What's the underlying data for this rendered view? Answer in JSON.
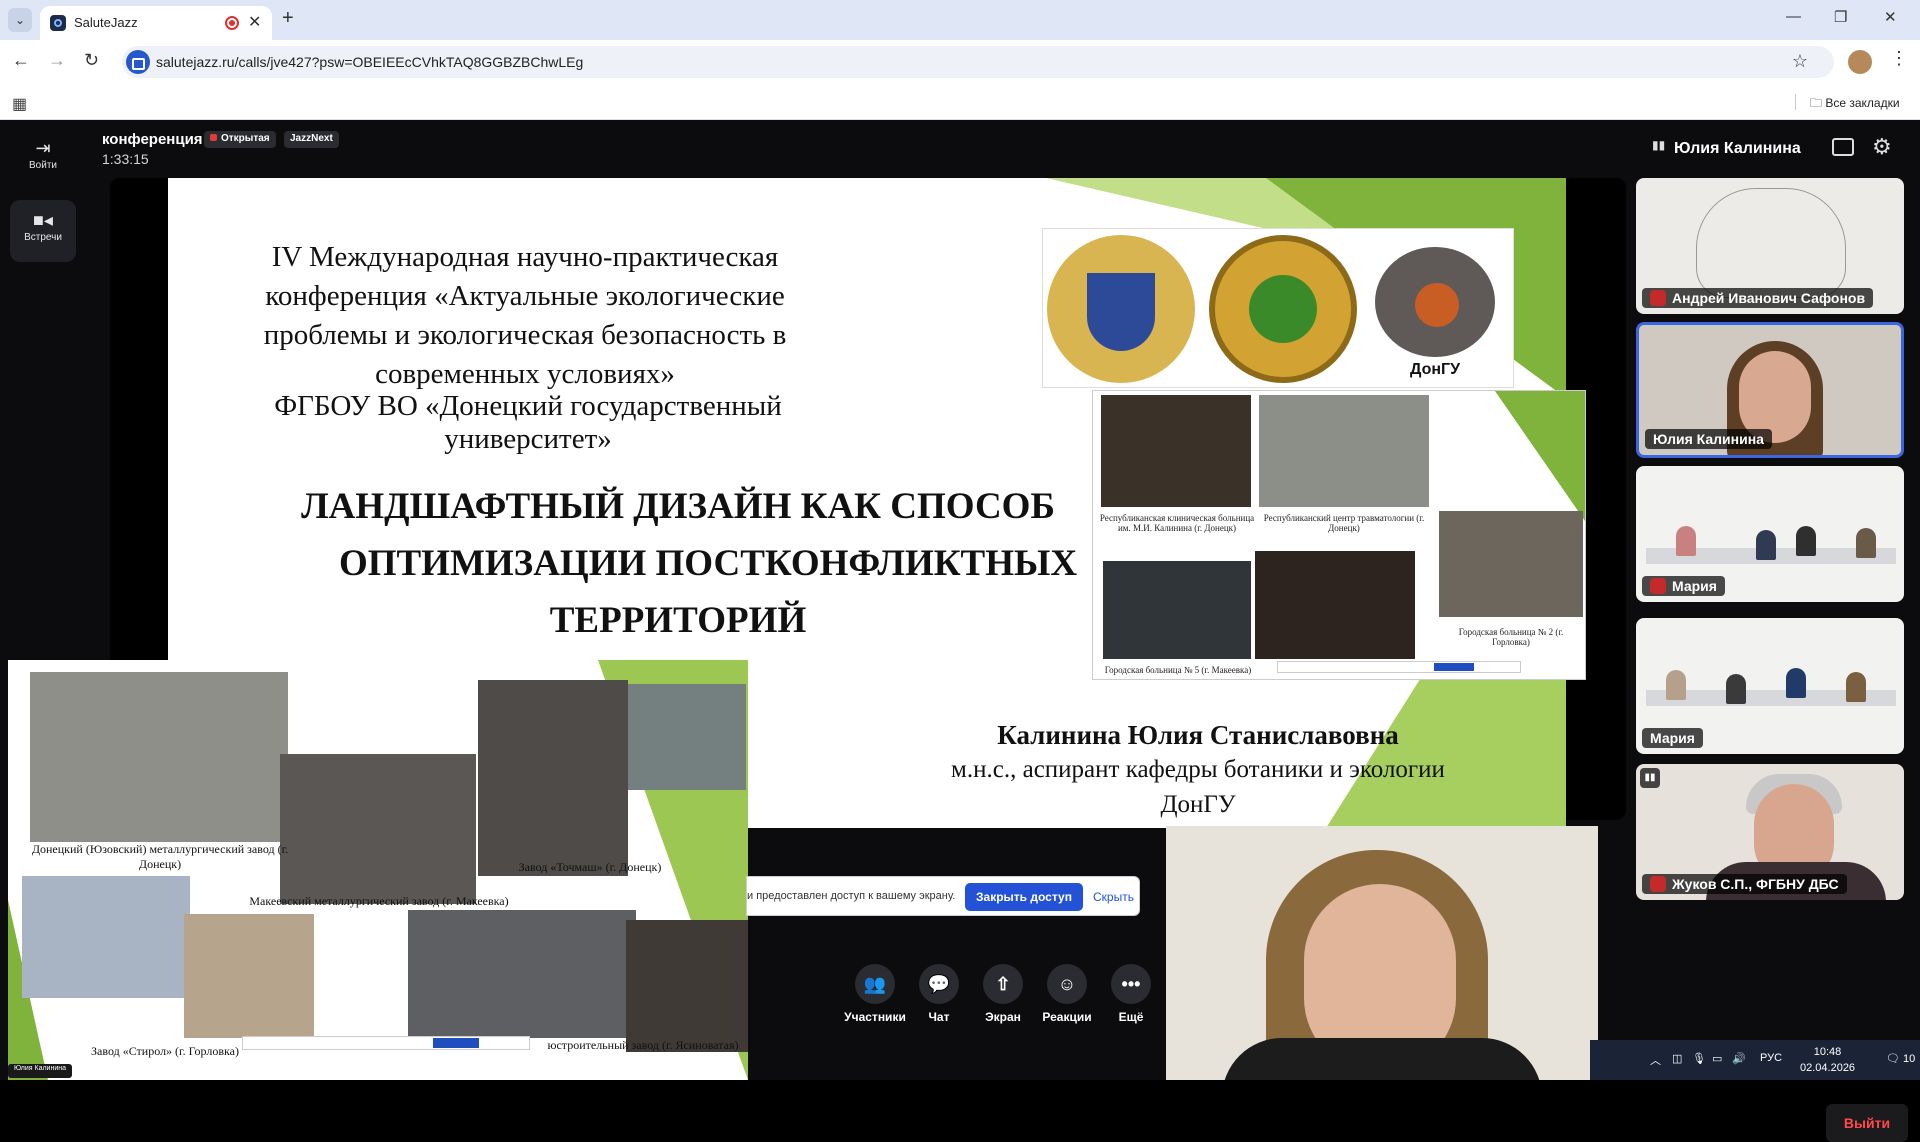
{
  "browser": {
    "tab_title": "SaluteJazz",
    "url": "salutejazz.ru/calls/jve427?psw=OBEIEEcCVhkTAQ8GGBZBChwLEg",
    "bookmarks_all": "Все закладки"
  },
  "rail": [
    {
      "label": "Войти",
      "icon": "login-icon"
    },
    {
      "label": "Встречи",
      "icon": "video-camera-icon"
    }
  ],
  "header": {
    "title": "конференция",
    "badge_open": "Открытая",
    "badge_app": "JazzNext",
    "timer": "1:33:15",
    "active_speaker": "Юлия Калинина"
  },
  "slide": {
    "conference": "IV Международная научно-практическая конференция «Актуальные экологические проблемы и экологическая безопасность в современных условиях»",
    "university": "ФГБОУ ВО «Донецкий государственный университет»",
    "topic_1": "ЛАНДШАФТНЫЙ ДИЗАЙН КАК СПОСОБ",
    "topic_2": "ОПТИМИЗАЦИИ ПОСТКОНФЛИКТНЫХ",
    "topic_3": "ТЕРРИТОРИЙ",
    "author": "Калинина Юлия Станиславовна",
    "position_1": "м.н.с., аспирант кафедры ботаники и экологии",
    "position_2": "ДонГУ",
    "logo_caption": "ДонГУ",
    "photo_captions": [
      "Республиканская клиническая больница им. М.И. Калинина (г. Донецк)",
      "Республиканский центр травматологии (г. Донецк)",
      "Городская больница № 2 (г. Горловка)",
      "Городская больница № 5 (г. Макеевка)"
    ]
  },
  "preview": {
    "captions": [
      "Донецкий (Юзовский) металлургический завод (г. Донецк)",
      "Завод «Точмаш» (г. Донецк)",
      "Макеевский металлургический завод (г. Макеевка)",
      "Завод «Стирол» (г. Горловка)",
      "юстроительный завод (г. Ясиноватая)"
    ],
    "user_tag": "Юлия Калинина"
  },
  "share_bar": {
    "text": "и предоставлен доступ к вашему экрану.",
    "close_label": "Закрыть доступ",
    "hide_label": "Скрыть"
  },
  "controls": [
    {
      "label": "Участники",
      "icon": "participants-icon"
    },
    {
      "label": "Чат",
      "icon": "chat-icon"
    },
    {
      "label": "Экран",
      "icon": "screen-share-icon"
    },
    {
      "label": "Реакции",
      "icon": "smile-icon"
    },
    {
      "label": "Ещё",
      "icon": "more-icon"
    }
  ],
  "participants": [
    {
      "name": "Андрей Иванович Сафонов",
      "muted": true
    },
    {
      "name": "Юлия Калинина",
      "muted": false,
      "active": true
    },
    {
      "name": "Мария",
      "muted": true
    },
    {
      "name": "Мария",
      "muted": false
    },
    {
      "name": "Жуков С.П., ФГБНУ ДБС",
      "muted": true
    }
  ],
  "exit_label": "Выйти",
  "tray": {
    "lang": "РУС",
    "time": "10:48",
    "date": "02.04.2026",
    "notifications": "10"
  },
  "colors": {
    "accent_blue": "#2352d6",
    "exit_red": "#ff4a4a",
    "slide_green": "#7fb33b"
  }
}
